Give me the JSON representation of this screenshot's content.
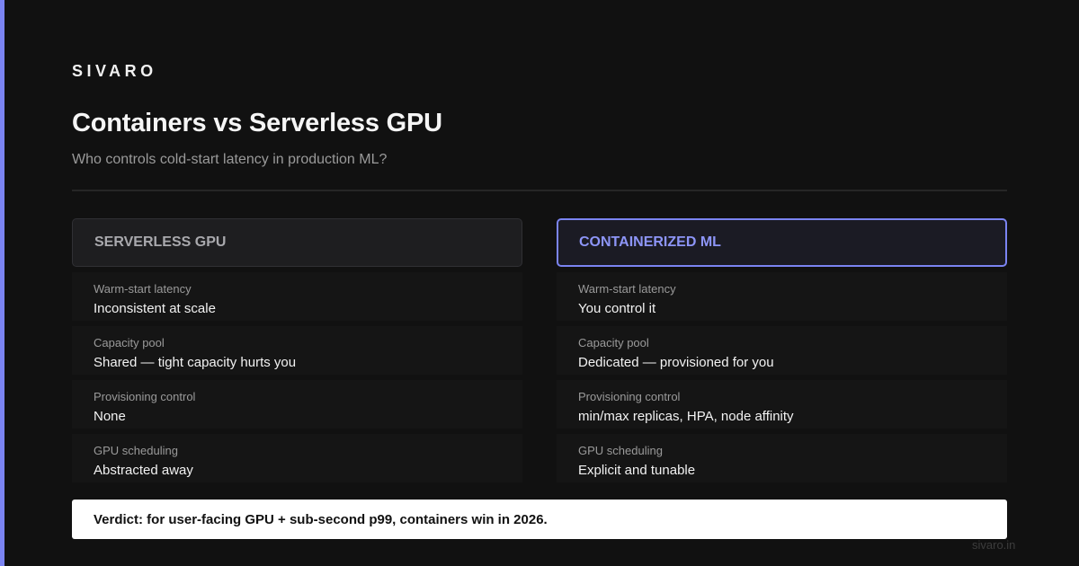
{
  "brand": "SIVARO",
  "title": "Containers vs Serverless GPU",
  "subtitle": "Who controls cold-start latency in production ML?",
  "columns": [
    {
      "heading": "SERVERLESS GPU",
      "rows": [
        {
          "label": "Warm-start latency",
          "value": "Inconsistent at scale"
        },
        {
          "label": "Capacity pool",
          "value": "Shared — tight capacity hurts you"
        },
        {
          "label": "Provisioning control",
          "value": "None"
        },
        {
          "label": "GPU scheduling",
          "value": "Abstracted away"
        }
      ]
    },
    {
      "heading": "CONTAINERIZED ML",
      "rows": [
        {
          "label": "Warm-start latency",
          "value": "You control it"
        },
        {
          "label": "Capacity pool",
          "value": "Dedicated — provisioned for you"
        },
        {
          "label": "Provisioning control",
          "value": "min/max replicas, HPA, node affinity"
        },
        {
          "label": "GPU scheduling",
          "value": "Explicit and tunable"
        }
      ]
    }
  ],
  "verdict": "Verdict: for user-facing GPU + sub-second p99, containers win in 2026.",
  "footer_url": "sivaro.in",
  "colors": {
    "accent": "#7b84f2",
    "background": "#111111",
    "verdict_background": "#ffffff"
  }
}
